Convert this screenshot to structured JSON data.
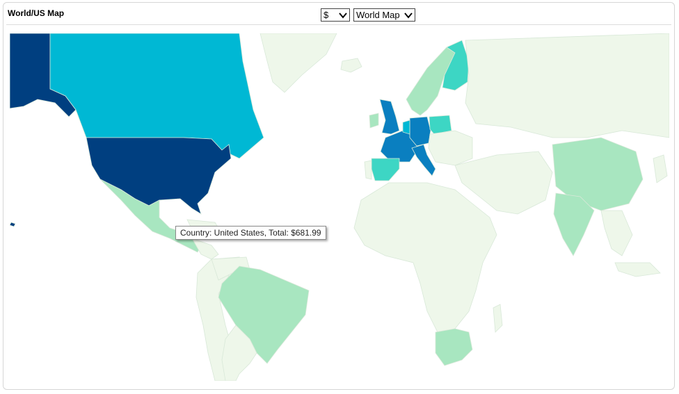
{
  "panel": {
    "title": "World/US Map"
  },
  "controls": {
    "currency": {
      "selected": "$"
    },
    "map_type": {
      "selected": "World Map"
    }
  },
  "tooltip": {
    "text": "Country: United States, Total: $681.99"
  },
  "colors": {
    "ocean": "#ffffff",
    "no_data": "#eef7ea",
    "level1": "#a8e6c0",
    "level2": "#3dd6c4",
    "level3": "#00b8d4",
    "level4": "#0a7fc0",
    "level5": "#003f80",
    "border": "#d8e8d8"
  }
}
